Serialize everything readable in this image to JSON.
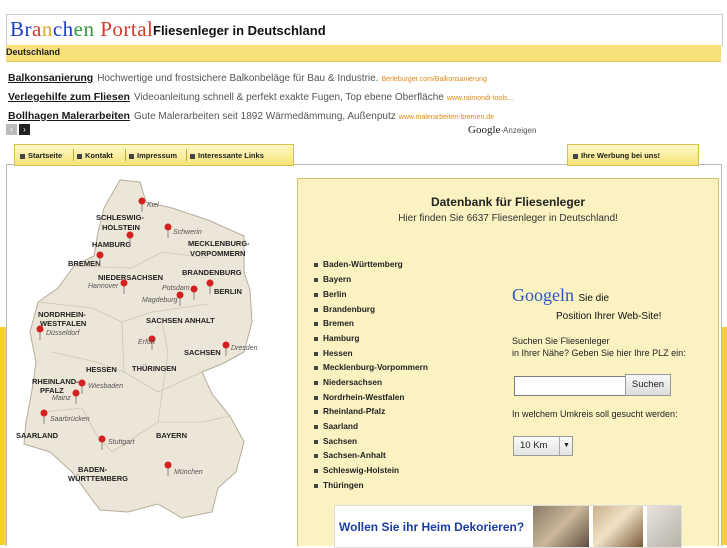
{
  "logo": {
    "b1": "Br",
    "b2": "a",
    "b3": "n",
    "b4": "ch",
    "b5": "en ",
    "b6": "Portal"
  },
  "page_title": "Fliesenleger in Deutschland",
  "region": "Deutschland",
  "ads": [
    {
      "title": "Balkonsanierung",
      "desc": "Hochwertige und frostsichere Balkonbeläge für Bau & Industrie.",
      "url": "Berleburger.com/Balkonsanierung"
    },
    {
      "title": "Verlegehilfe zum Fliesen",
      "desc": "Videoanleitung schnell & perfekt exakte Fugen, Top ebene Oberfläche",
      "url": "www.raimondi-tools..."
    },
    {
      "title": "Bollhagen Malerarbeiten",
      "desc": "Gute Malerarbeiten seit 1892 Wärmedämmung, Außenputz",
      "url": "www.malerarbeiten-bremen.de"
    }
  ],
  "ad_prev": "‹",
  "ad_next": "›",
  "adchoice": {
    "google": "Google",
    "label": "-Anzeigen"
  },
  "nav": {
    "items": [
      "Startseite",
      "Kontakt",
      "Impressum",
      "Interessante Links"
    ],
    "right": "Ihre Werbung bei uns!"
  },
  "map": {
    "states": [
      "SCHLESWIG-",
      "HOLSTEIN",
      "HAMBURG",
      "MECKLENBURG-",
      "VORPOMMERN",
      "BREMEN",
      "NIEDERSACHSEN",
      "BRANDENBURG",
      "BERLIN",
      "SACHSEN ANHALT",
      "NORDRHEIN-",
      "WESTFALEN",
      "HESSEN",
      "THÜRINGEN",
      "SACHSEN",
      "RHEINLAND-",
      "PFALZ",
      "SAARLAND",
      "BAYERN",
      "BADEN-",
      "WÜRTTEMBERG"
    ],
    "cities": [
      "Kiel",
      "Schwerin",
      "Hannover",
      "Potsdam",
      "Magdeburg",
      "Düsseldorf",
      "Erfurt",
      "Dresden",
      "Wiesbaden",
      "Mainz",
      "Saarbrücken",
      "Stuttgart",
      "München"
    ]
  },
  "db": {
    "title": "Datenbank für Fliesenleger",
    "subtitle": "Hier finden Sie 6637 Fliesenleger in Deutschland!",
    "states": [
      "Baden-Württemberg",
      "Bayern",
      "Berlin",
      "Brandenburg",
      "Bremen",
      "Hamburg",
      "Hessen",
      "Mecklenburg-Vorpommern",
      "Niedersachsen",
      "Nordrhein-Westfalen",
      "Rheinland-Pfalz",
      "Saarland",
      "Sachsen",
      "Sachsen-Anhalt",
      "Schleswig-Holstein",
      "Thüringen"
    ]
  },
  "googeln": {
    "g": "Googeln",
    "text1": "Sie die",
    "text2": "Position Ihrer Web-Site!"
  },
  "plz": {
    "line1": "Suchen Sie Fliesenleger",
    "line2": "in Ihrer Nähe? Geben Sie hier Ihre PLZ ein:",
    "button": "Suchen",
    "placeholder": ""
  },
  "radius": {
    "label": "In welchem Umkreis soll gesucht werden:",
    "value": "10 Km"
  },
  "banner": {
    "text": "Wollen Sie ihr Heim Dekorieren?"
  },
  "colors": {
    "band": "#f2cf38",
    "panel": "#fbf2c2",
    "accent": "#1b3da6",
    "pin": "#d42020"
  }
}
